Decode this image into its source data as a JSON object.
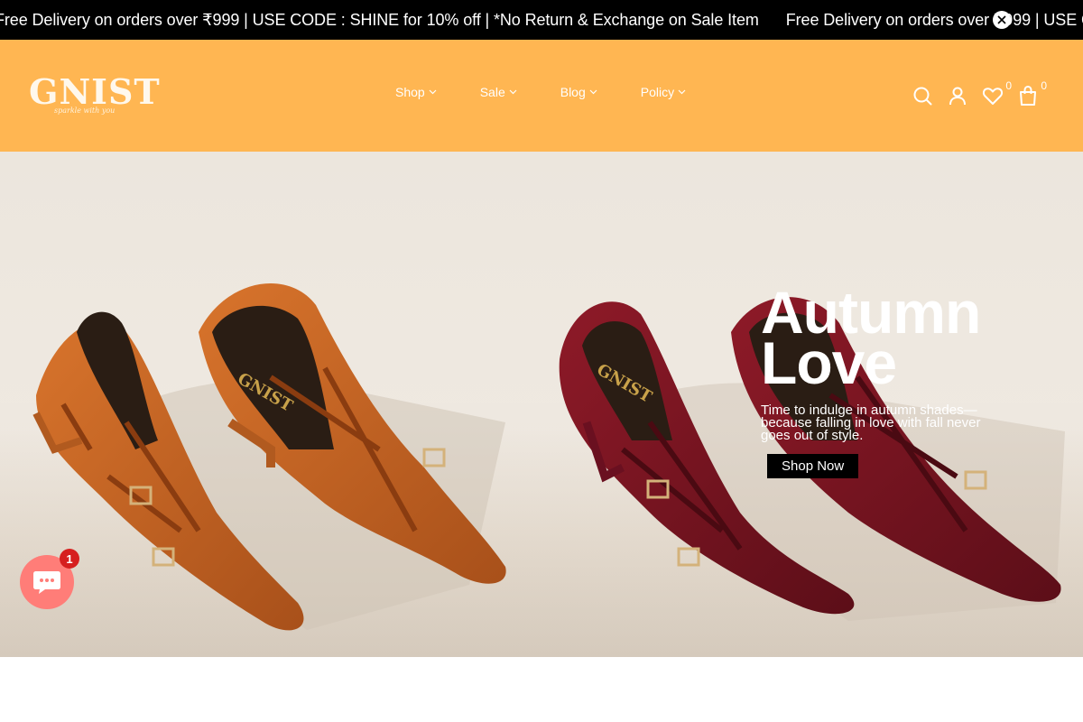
{
  "announcement": {
    "messages": [
      "Free Delivery on orders over ₹999 | USE CODE : SHINE for 10% off | *No Return & Exchange on Sale Item",
      "Free Delivery on orders over ₹999 | USE CODE : SHINE for 10% off"
    ]
  },
  "header": {
    "logo": "GNIST",
    "logo_tagline": "sparkle with you",
    "nav": [
      {
        "label": "Shop"
      },
      {
        "label": "Sale"
      },
      {
        "label": "Blog"
      },
      {
        "label": "Policy"
      }
    ],
    "wishlist_count": "0",
    "cart_count": "0"
  },
  "hero": {
    "title_line1": "Autumn",
    "title_line2": "Love",
    "subtitle": "Time to indulge in autumn shades—because falling in love with fall never goes out of style.",
    "cta": "Shop Now",
    "shoe_brand": "GNIST"
  },
  "chat": {
    "badge": "1"
  },
  "colors": {
    "header_bg": "#ffb652",
    "announcement_bg": "#000000",
    "chat_bg": "#ff7d78",
    "tan_shoe": "#c8621f",
    "burgundy_shoe": "#7a1420"
  }
}
